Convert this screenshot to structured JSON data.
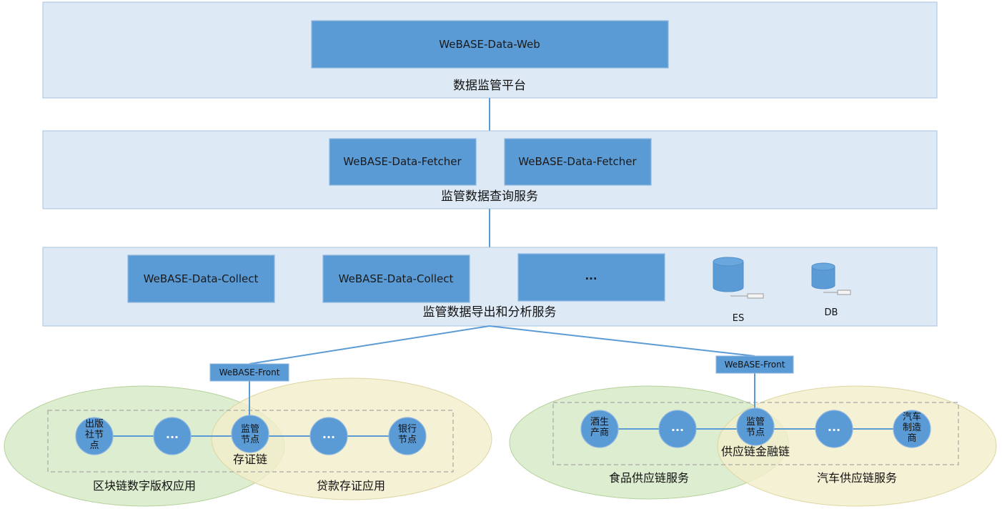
{
  "layers": {
    "web": {
      "title": "数据监管平台",
      "component": "WeBASE-Data-Web"
    },
    "fetcher": {
      "title": "监管数据查询服务",
      "components": [
        "WeBASE-Data-Fetcher",
        "WeBASE-Data-Fetcher"
      ]
    },
    "collect": {
      "title": "监管数据导出和分析服务",
      "components": [
        "WeBASE-Data-Collect",
        "WeBASE-Data-Collect",
        "..."
      ],
      "storage": [
        "ES",
        "DB"
      ]
    }
  },
  "fronts": [
    "WeBASE-Front",
    "WeBASE-Front"
  ],
  "left_group": {
    "chain_label": "存证链",
    "app_left": "区块链数字版权应用",
    "app_right": "贷款存证应用",
    "nodes": [
      "出版\n社节\n点",
      "...",
      "监管\n节点",
      "...",
      "银行\n节点"
    ]
  },
  "right_group": {
    "chain_label": "供应链金融链",
    "app_left": "食品供应链服务",
    "app_right": "汽车供应链服务",
    "nodes": [
      "酒生\n产商",
      "...",
      "监管\n节点",
      "...",
      "汽车\n制造\n商"
    ]
  },
  "colors": {
    "layer_fill": "#dde9f5",
    "component_blue": "#5b9bd5",
    "green_area": "#d5e8c4",
    "yellow_area": "#f3eecb"
  }
}
